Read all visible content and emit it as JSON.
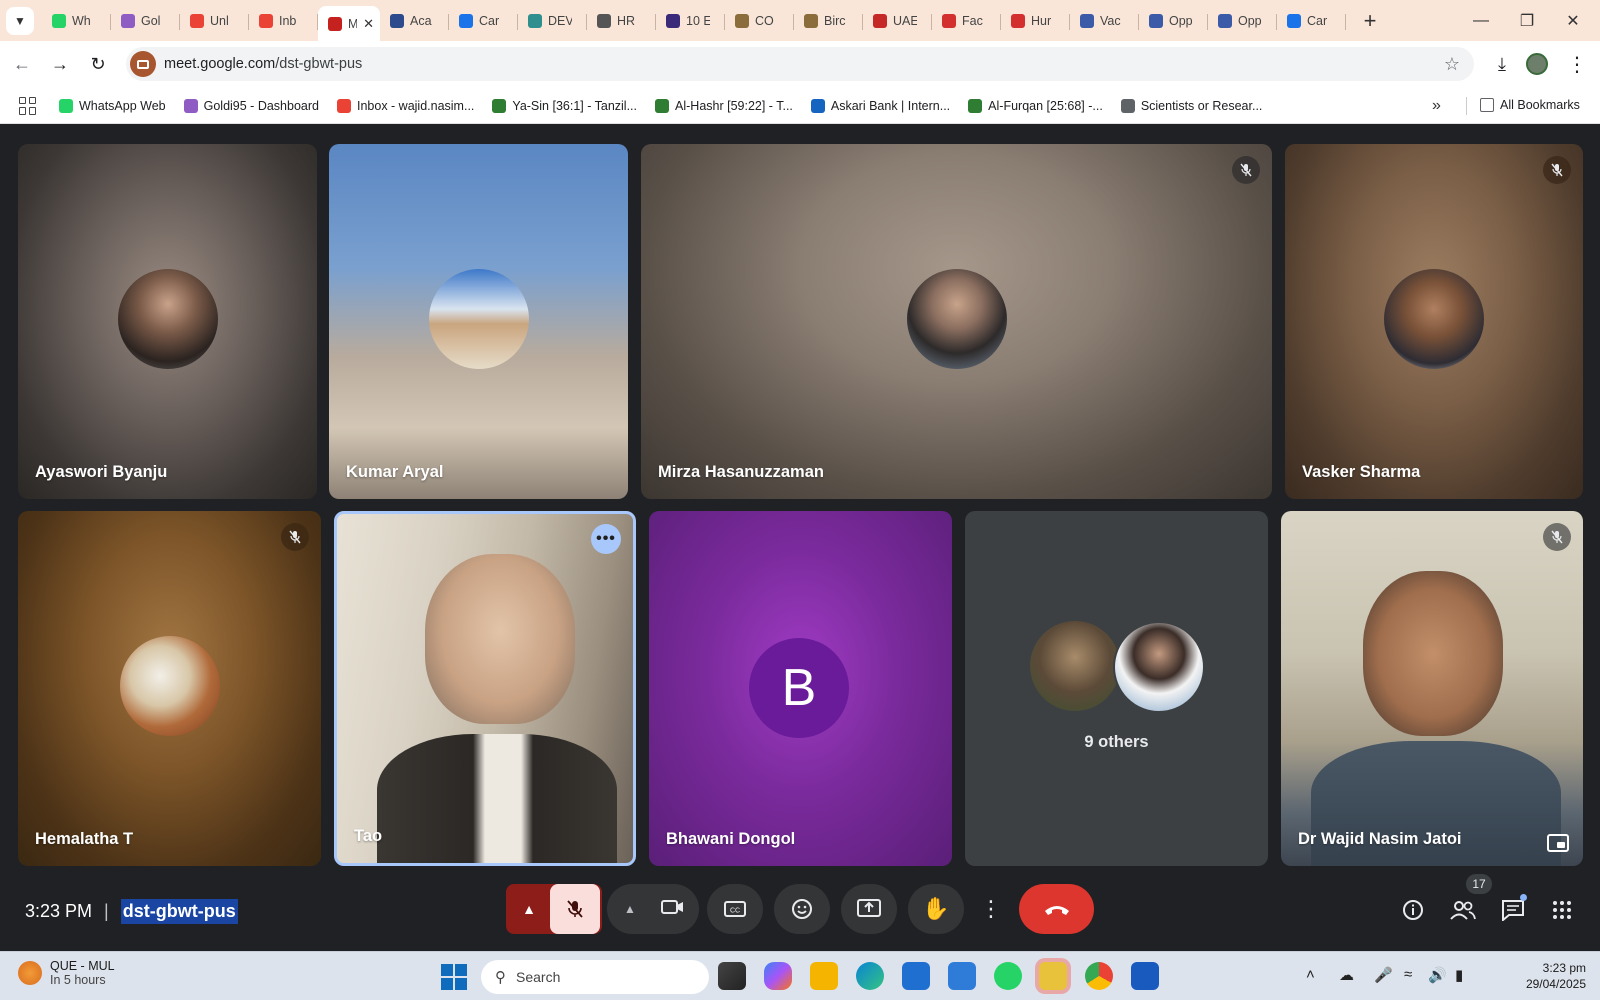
{
  "browser": {
    "tabs": [
      {
        "label": "Wh",
        "color": "#25d366"
      },
      {
        "label": "Gol",
        "color": "#8e5cc2"
      },
      {
        "label": "Unl",
        "color": "#ea4335"
      },
      {
        "label": "Inb",
        "color": "#ea4335"
      },
      {
        "label": "M",
        "color": "#c5221f",
        "active": true
      },
      {
        "label": "Aca",
        "color": "#2c4a8c"
      },
      {
        "label": "Car",
        "color": "#1a73e8"
      },
      {
        "label": "DEV",
        "color": "#2f8f8f"
      },
      {
        "label": "HR",
        "color": "#555555"
      },
      {
        "label": "10 E",
        "color": "#3b2a7a"
      },
      {
        "label": "CO",
        "color": "#8a6d3b"
      },
      {
        "label": "Birc",
        "color": "#8a6d3b"
      },
      {
        "label": "UAE",
        "color": "#c62828"
      },
      {
        "label": "Fac",
        "color": "#d32f2f"
      },
      {
        "label": "Hur",
        "color": "#d32f2f"
      },
      {
        "label": "Vac",
        "color": "#3b5ba8"
      },
      {
        "label": "Opp",
        "color": "#3b5ba8"
      },
      {
        "label": "Opp",
        "color": "#3b5ba8"
      },
      {
        "label": "Car",
        "color": "#1a73e8"
      }
    ],
    "url_host": "meet.google.com",
    "url_path": "/dst-gbwt-pus",
    "bookmarks": [
      {
        "label": "WhatsApp Web",
        "color": "#25d366"
      },
      {
        "label": "Goldi95 - Dashboard",
        "color": "#8e5cc2"
      },
      {
        "label": "Inbox - wajid.nasim...",
        "color": "#ea4335"
      },
      {
        "label": "Ya-Sin [36:1] - Tanzil...",
        "color": "#2e7d32"
      },
      {
        "label": "Al-Hashr [59:22] - T...",
        "color": "#2e7d32"
      },
      {
        "label": "Askari Bank | Intern...",
        "color": "#1565c0"
      },
      {
        "label": "Al-Furqan [25:68] -...",
        "color": "#2e7d32"
      },
      {
        "label": "Scientists or Resear...",
        "color": "#5f6368"
      }
    ],
    "all_bookmarks": "All Bookmarks"
  },
  "meet": {
    "participants": [
      {
        "name": "Ayaswori Byanju"
      },
      {
        "name": "Kumar Aryal"
      },
      {
        "name": "Mirza Hasanuzzaman"
      },
      {
        "name": "Vasker Sharma"
      },
      {
        "name": "Hemalatha T"
      },
      {
        "name": "Tao"
      },
      {
        "name": "Bhawani Dongol",
        "initial": "B"
      },
      {
        "name": "Dr Wajid Nasim Jatoi"
      }
    ],
    "others_label": "9 others",
    "time": "3:23 PM",
    "separator": "|",
    "meeting_code": "dst-gbwt-pus",
    "participant_count": "17"
  },
  "taskbar": {
    "weather_title": "QUE - MUL",
    "weather_sub": "In 5 hours",
    "search_placeholder": "Search",
    "clock_time": "3:23 pm",
    "clock_date": "29/04/2025"
  }
}
